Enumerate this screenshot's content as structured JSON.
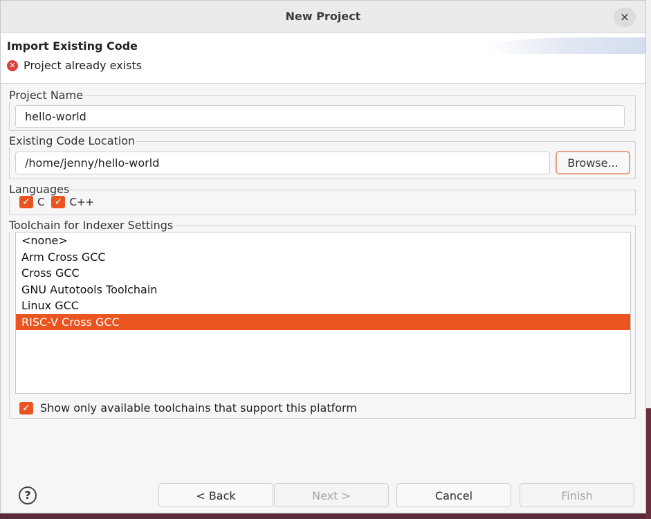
{
  "window": {
    "title": "New Project",
    "close_label": "×"
  },
  "header": {
    "title": "Import Existing Code",
    "message": "Project already exists",
    "message_icon": "error-icon"
  },
  "project_name": {
    "legend": "Project Name",
    "value": "hello-world"
  },
  "code_location": {
    "legend": "Existing Code Location",
    "value": "/home/jenny/hello-world",
    "browse_label": "Browse..."
  },
  "languages": {
    "legend": "Languages",
    "items": [
      {
        "label": "C",
        "checked": true
      },
      {
        "label": "C++",
        "checked": true
      }
    ]
  },
  "toolchain": {
    "legend": "Toolchain for Indexer Settings",
    "items": [
      {
        "label": "<none>",
        "selected": false
      },
      {
        "label": "Arm Cross GCC",
        "selected": false
      },
      {
        "label": "Cross GCC",
        "selected": false
      },
      {
        "label": "GNU Autotools Toolchain",
        "selected": false
      },
      {
        "label": "Linux GCC",
        "selected": false
      },
      {
        "label": "RISC-V Cross GCC",
        "selected": true
      }
    ],
    "show_only_label": "Show only available toolchains that support this platform",
    "show_only_checked": true
  },
  "footer": {
    "help_label": "?",
    "back_label": "< Back",
    "next_label": "Next >",
    "cancel_label": "Cancel",
    "finish_label": "Finish"
  },
  "colors": {
    "accent": "#e95420",
    "error": "#d9413f"
  }
}
